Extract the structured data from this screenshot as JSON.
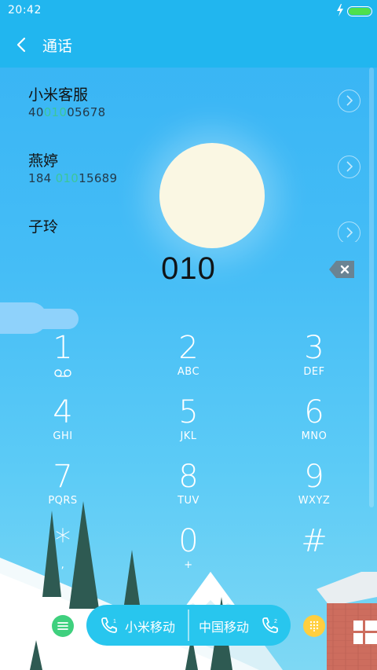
{
  "status_bar": {
    "time": "20:42"
  },
  "header": {
    "title": "通话"
  },
  "contacts": [
    {
      "name": "小米客服",
      "number_pre": "40",
      "number_match": "010",
      "number_post": "05678"
    },
    {
      "name": "燕婷",
      "number_pre": "184 ",
      "number_match": "010",
      "number_post": "15689"
    },
    {
      "name": "子玲",
      "number_pre": "",
      "number_match": "",
      "number_post": ""
    }
  ],
  "dialed_number": "010",
  "keypad": [
    {
      "digit": "1",
      "letters": ""
    },
    {
      "digit": "2",
      "letters": "ABC"
    },
    {
      "digit": "3",
      "letters": "DEF"
    },
    {
      "digit": "4",
      "letters": "GHI"
    },
    {
      "digit": "5",
      "letters": "JKL"
    },
    {
      "digit": "6",
      "letters": "MNO"
    },
    {
      "digit": "7",
      "letters": "PQRS"
    },
    {
      "digit": "8",
      "letters": "TUV"
    },
    {
      "digit": "9",
      "letters": "WXYZ"
    },
    {
      "digit": "*",
      "letters": ","
    },
    {
      "digit": "0",
      "letters": "+"
    },
    {
      "digit": "#",
      "letters": ""
    }
  ],
  "call_buttons": {
    "sim1": {
      "label": "小米移动",
      "slot": "1"
    },
    "sim2": {
      "label": "中国移动",
      "slot": "2"
    }
  },
  "colors": {
    "header_bg": "#21b6ef",
    "match_highlight": "#3cc69a",
    "call_pill": "#28c6ee",
    "menu_button": "#3fd07e",
    "pad_button": "#ffcf3f",
    "battery": "#4ee04e"
  },
  "icons": {
    "back": "chevron-left-icon",
    "backspace": "backspace-icon",
    "voicemail": "voicemail-icon",
    "menu": "menu-icon",
    "dialpad": "dialpad-icon",
    "phone": "phone-icon"
  }
}
